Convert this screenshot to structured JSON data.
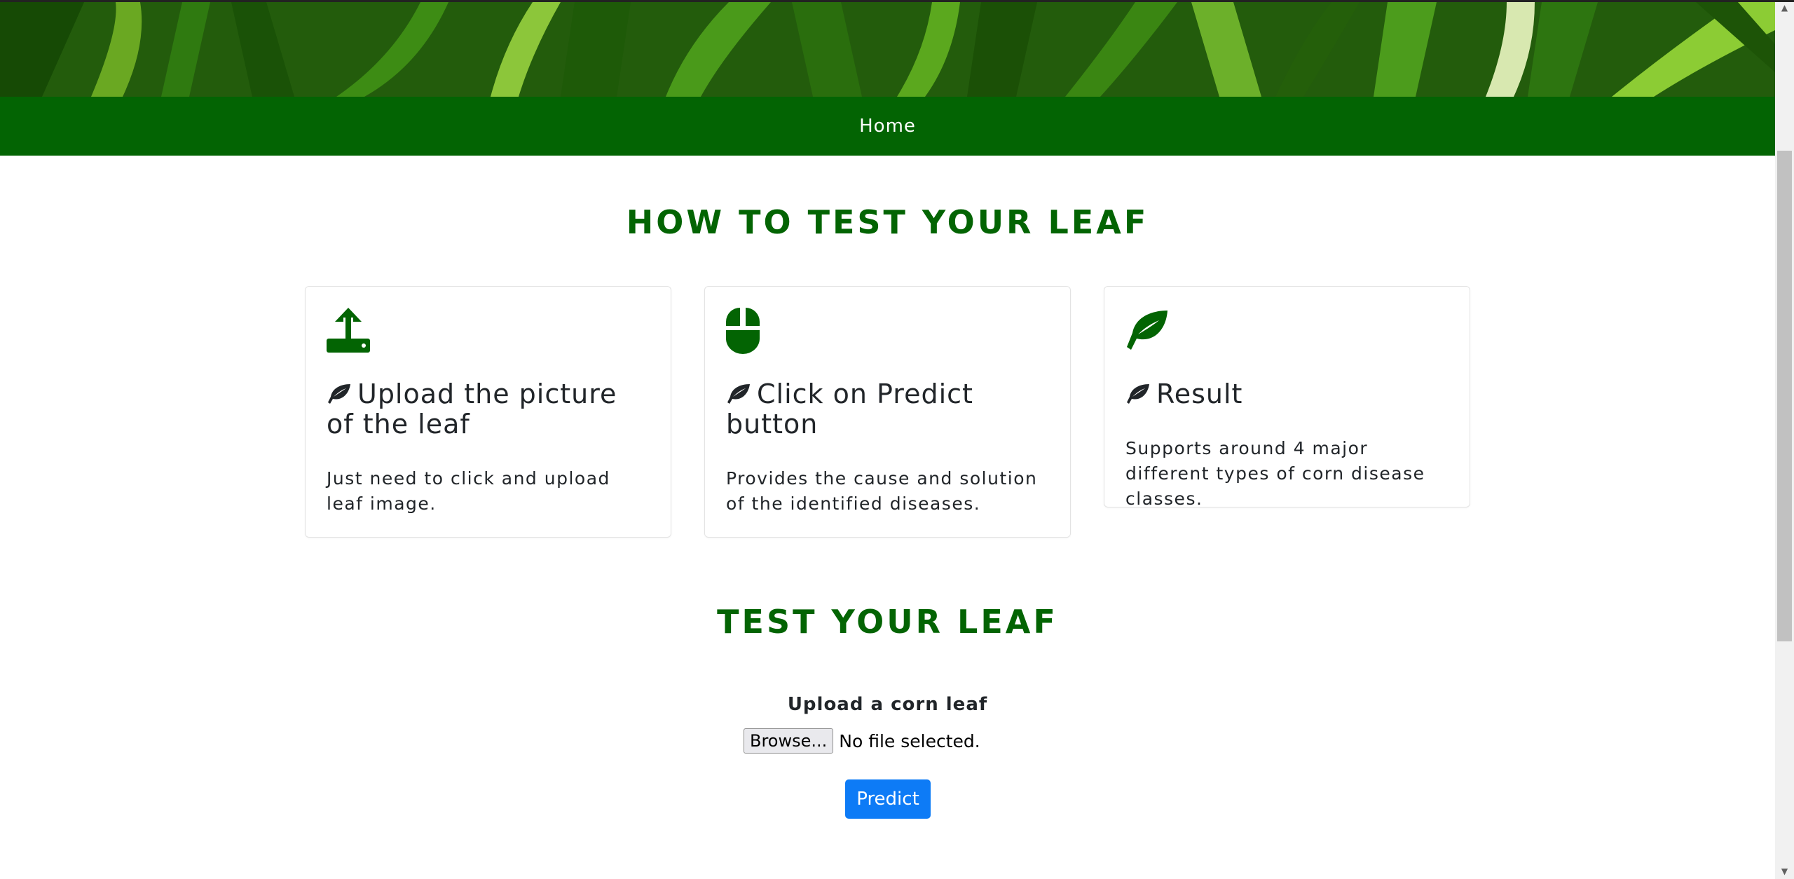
{
  "nav": {
    "home_label": "Home"
  },
  "how_to": {
    "title": "HOW TO TEST YOUR LEAF",
    "cards": [
      {
        "icon": "upload-icon",
        "title": "Upload the picture of the leaf",
        "text": "Just need to click and upload leaf image."
      },
      {
        "icon": "mouse-icon",
        "title": "Click on Predict button",
        "text": "Provides the cause and solution of the identified diseases."
      },
      {
        "icon": "leaf-icon",
        "title": "Result",
        "text": "Supports around 4 major different types of corn disease classes."
      }
    ]
  },
  "test": {
    "title": "TEST YOUR LEAF",
    "upload_label": "Upload a corn leaf",
    "browse_label": "Browse...",
    "file_status": "No file selected.",
    "predict_label": "Predict"
  },
  "colors": {
    "accent": "#036403",
    "button": "#0d7bf6"
  }
}
